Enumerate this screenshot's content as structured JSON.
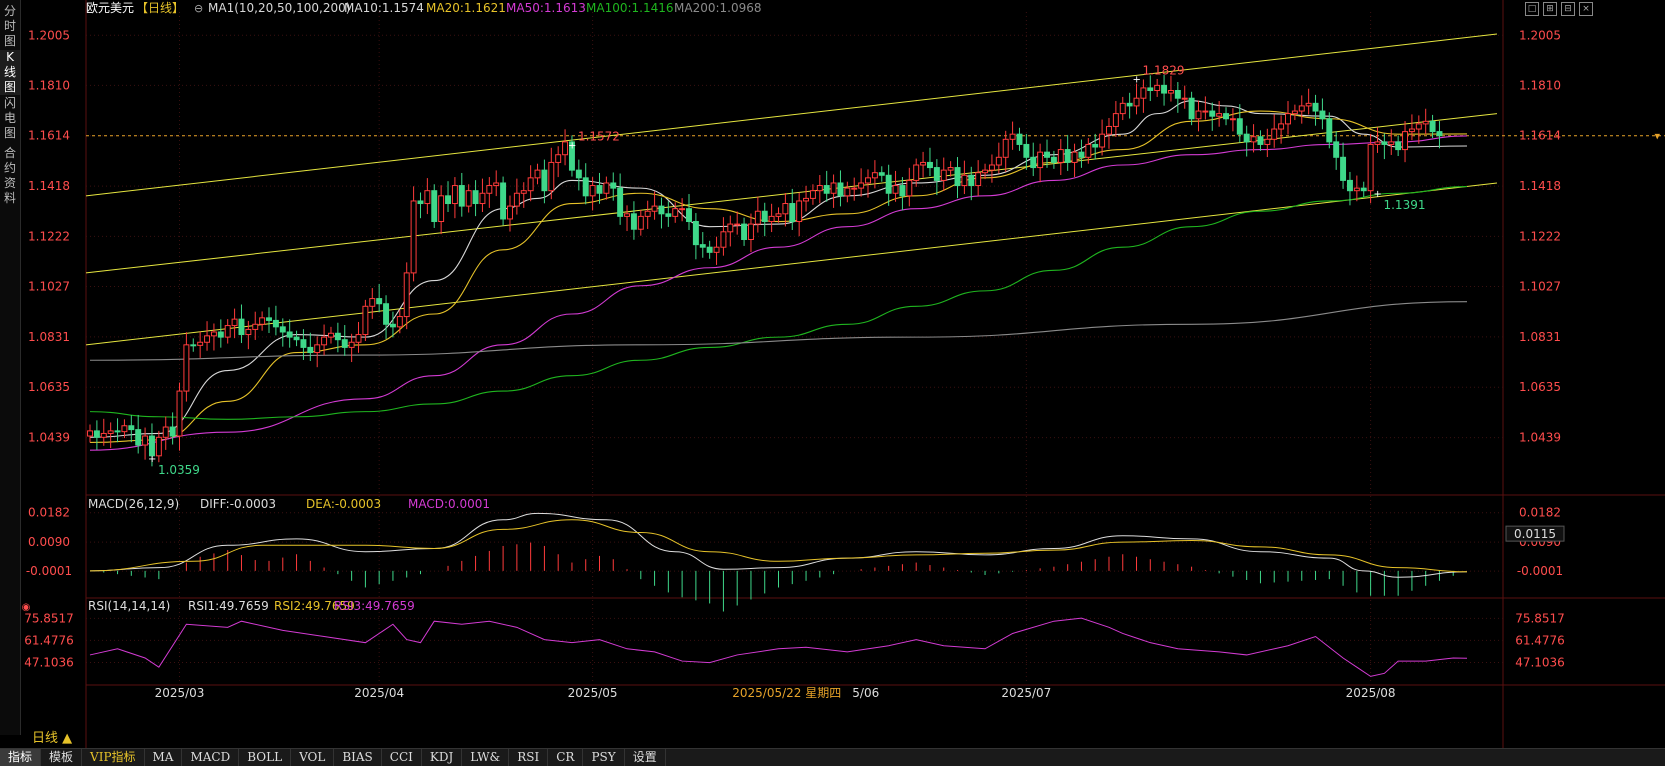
{
  "sidebar": {
    "tabs": [
      {
        "label": "分时图",
        "active": false
      },
      {
        "label": "K线图",
        "active": true
      },
      {
        "label": "闪电图",
        "active": false
      },
      {
        "label": "合约资料",
        "active": false
      }
    ]
  },
  "header": {
    "symbol": "欧元美元",
    "period_bracket": "【日线】",
    "ma_legend": [
      {
        "text": "MA1(10,20,50,100,200)",
        "color": "#d8d8d8"
      },
      {
        "text": "MA10:1.1574",
        "color": "#d8d8d8"
      },
      {
        "text": "MA20:1.1621",
        "color": "#e6c229"
      },
      {
        "text": "MA50:1.1613",
        "color": "#d33bd3"
      },
      {
        "text": "MA100:1.1416",
        "color": "#1fb51f"
      },
      {
        "text": "MA200:1.0968",
        "color": "#8a8a8a"
      }
    ]
  },
  "window_controls": [
    "□",
    "⊞",
    "⊟",
    "×"
  ],
  "chart_data": {
    "type": "candlestick",
    "price_axis_ticks": [
      "1.2005",
      "1.1810",
      "1.1614",
      "1.1418",
      "1.1222",
      "1.1027",
      "1.0831",
      "1.0635",
      "1.0439"
    ],
    "price_range": [
      1.034,
      1.208
    ],
    "current_price_label": "1.1614",
    "annotations": [
      {
        "text": "1.0359",
        "value": 1.0359,
        "bar": 9
      },
      {
        "text": "1.1572",
        "value": 1.1572,
        "bar": 70
      },
      {
        "text": "1.1829",
        "value": 1.1829,
        "bar": 152
      },
      {
        "text": "1.1391",
        "value": 1.1391,
        "bar": 187
      }
    ],
    "x_axis_labels": [
      {
        "text": "2025/03",
        "bar": 13
      },
      {
        "text": "2025/04",
        "bar": 42
      },
      {
        "text": "2025/05",
        "bar": 73
      },
      {
        "text": "2025/07",
        "bar": 136
      },
      {
        "text": "2025/08",
        "bar": 186
      }
    ],
    "crosshair_date": "2025/05/22 星期四",
    "crosshair_suffix": "5/06",
    "closes": [
      1.0465,
      1.044,
      1.0455,
      1.0465,
      1.0462,
      1.0485,
      1.047,
      1.041,
      1.0445,
      1.0368,
      1.044,
      1.048,
      1.0445,
      1.062,
      1.08,
      1.0798,
      1.081,
      1.0835,
      1.085,
      1.083,
      1.0875,
      1.09,
      1.084,
      1.086,
      1.088,
      1.0905,
      1.0895,
      1.087,
      1.085,
      1.083,
      1.082,
      1.079,
      1.077,
      1.08,
      1.083,
      1.0845,
      1.082,
      1.079,
      1.081,
      1.084,
      1.095,
      1.098,
      1.096,
      1.088,
      1.087,
      1.091,
      1.108,
      1.136,
      1.135,
      1.14,
      1.128,
      1.138,
      1.135,
      1.142,
      1.134,
      1.14,
      1.135,
      1.139,
      1.142,
      1.143,
      1.129,
      1.134,
      1.139,
      1.14,
      1.145,
      1.148,
      1.14,
      1.151,
      1.154,
      1.159,
      1.148,
      1.145,
      1.138,
      1.142,
      1.139,
      1.143,
      1.141,
      1.13,
      1.131,
      1.125,
      1.13,
      1.132,
      1.134,
      1.131,
      1.13,
      1.133,
      1.133,
      1.128,
      1.119,
      1.118,
      1.116,
      1.118,
      1.124,
      1.127,
      1.127,
      1.121,
      1.127,
      1.132,
      1.128,
      1.13,
      1.131,
      1.135,
      1.128,
      1.136,
      1.137,
      1.14,
      1.142,
      1.139,
      1.143,
      1.138,
      1.141,
      1.141,
      1.143,
      1.145,
      1.147,
      1.146,
      1.139,
      1.142,
      1.138,
      1.144,
      1.15,
      1.151,
      1.149,
      1.144,
      1.148,
      1.149,
      1.142,
      1.146,
      1.142,
      1.147,
      1.148,
      1.15,
      1.153,
      1.16,
      1.162,
      1.158,
      1.153,
      1.149,
      1.155,
      1.153,
      1.151,
      1.156,
      1.151,
      1.155,
      1.153,
      1.158,
      1.157,
      1.162,
      1.165,
      1.17,
      1.174,
      1.173,
      1.176,
      1.18,
      1.179,
      1.181,
      1.178,
      1.179,
      1.176,
      1.176,
      1.168,
      1.171,
      1.171,
      1.169,
      1.17,
      1.168,
      1.168,
      1.162,
      1.159,
      1.161,
      1.158,
      1.16,
      1.164,
      1.166,
      1.17,
      1.171,
      1.173,
      1.174,
      1.171,
      1.168,
      1.159,
      1.153,
      1.144,
      1.14,
      1.141,
      1.14,
      1.158,
      1.159,
      1.158,
      1.159,
      1.156,
      1.163,
      1.164,
      1.166,
      1.167,
      1.163,
      1.1614
    ],
    "moving_averages": [
      {
        "name": "MA10",
        "color": "#d8d8d8",
        "points": [
          [
            0,
            1.044
          ],
          [
            10,
            1.0455
          ],
          [
            20,
            1.07
          ],
          [
            30,
            1.084
          ],
          [
            40,
            1.083
          ],
          [
            50,
            1.105
          ],
          [
            60,
            1.133
          ],
          [
            65,
            1.137
          ],
          [
            70,
            1.144
          ],
          [
            80,
            1.141
          ],
          [
            90,
            1.126
          ],
          [
            100,
            1.127
          ],
          [
            110,
            1.138
          ],
          [
            120,
            1.143
          ],
          [
            130,
            1.146
          ],
          [
            140,
            1.154
          ],
          [
            150,
            1.162
          ],
          [
            155,
            1.17
          ],
          [
            160,
            1.175
          ],
          [
            165,
            1.173
          ],
          [
            170,
            1.17
          ],
          [
            180,
            1.169
          ],
          [
            185,
            1.162
          ],
          [
            190,
            1.157
          ],
          [
            200,
            1.1574
          ]
        ]
      },
      {
        "name": "MA20",
        "color": "#e6c229",
        "points": [
          [
            0,
            1.042
          ],
          [
            10,
            1.043
          ],
          [
            20,
            1.058
          ],
          [
            30,
            1.077
          ],
          [
            40,
            1.08
          ],
          [
            50,
            1.092
          ],
          [
            60,
            1.117
          ],
          [
            70,
            1.135
          ],
          [
            80,
            1.139
          ],
          [
            90,
            1.133
          ],
          [
            100,
            1.128
          ],
          [
            110,
            1.131
          ],
          [
            120,
            1.138
          ],
          [
            130,
            1.145
          ],
          [
            140,
            1.151
          ],
          [
            150,
            1.156
          ],
          [
            160,
            1.167
          ],
          [
            170,
            1.171
          ],
          [
            180,
            1.168
          ],
          [
            190,
            1.162
          ],
          [
            200,
            1.1621
          ]
        ]
      },
      {
        "name": "MA50",
        "color": "#d33bd3",
        "points": [
          [
            0,
            1.039
          ],
          [
            20,
            1.046
          ],
          [
            40,
            1.059
          ],
          [
            50,
            1.068
          ],
          [
            60,
            1.08
          ],
          [
            70,
            1.092
          ],
          [
            80,
            1.103
          ],
          [
            90,
            1.11
          ],
          [
            100,
            1.118
          ],
          [
            110,
            1.126
          ],
          [
            120,
            1.133
          ],
          [
            130,
            1.138
          ],
          [
            140,
            1.144
          ],
          [
            150,
            1.15
          ],
          [
            160,
            1.154
          ],
          [
            170,
            1.156
          ],
          [
            180,
            1.158
          ],
          [
            190,
            1.159
          ],
          [
            200,
            1.1613
          ]
        ]
      },
      {
        "name": "MA100",
        "color": "#1fb51f",
        "points": [
          [
            0,
            1.054
          ],
          [
            10,
            1.052
          ],
          [
            20,
            1.051
          ],
          [
            30,
            1.052
          ],
          [
            40,
            1.054
          ],
          [
            50,
            1.057
          ],
          [
            60,
            1.062
          ],
          [
            70,
            1.068
          ],
          [
            80,
            1.074
          ],
          [
            90,
            1.079
          ],
          [
            100,
            1.083
          ],
          [
            110,
            1.088
          ],
          [
            120,
            1.095
          ],
          [
            130,
            1.101
          ],
          [
            140,
            1.109
          ],
          [
            150,
            1.118
          ],
          [
            160,
            1.126
          ],
          [
            170,
            1.132
          ],
          [
            180,
            1.136
          ],
          [
            190,
            1.139
          ],
          [
            200,
            1.1416
          ]
        ]
      },
      {
        "name": "MA200",
        "color": "#8a8a8a",
        "points": [
          [
            0,
            1.074
          ],
          [
            40,
            1.076
          ],
          [
            80,
            1.08
          ],
          [
            120,
            1.083
          ],
          [
            160,
            1.088
          ],
          [
            200,
            1.0968
          ]
        ]
      }
    ],
    "trendlines": [
      {
        "from": [
          0,
          1.138
        ],
        "to": [
          210,
          1.201
        ]
      },
      {
        "from": [
          0,
          1.108
        ],
        "to": [
          210,
          1.17
        ]
      },
      {
        "from": [
          0,
          1.08
        ],
        "to": [
          210,
          1.143
        ]
      }
    ],
    "macd": {
      "title": "MACD(26,12,9)",
      "diff": "DIFF:-0.0003",
      "dea": "DEA:-0.0003",
      "macd": "MACD:0.0001",
      "ticks": [
        "0.0182",
        "0.0090",
        "-0.0001"
      ],
      "current_label": "0.0115",
      "range": [
        -0.006,
        0.02
      ],
      "diff_points": [
        [
          0,
          0.0
        ],
        [
          10,
          0.001
        ],
        [
          20,
          0.008
        ],
        [
          30,
          0.01
        ],
        [
          40,
          0.006
        ],
        [
          50,
          0.007
        ],
        [
          60,
          0.016
        ],
        [
          65,
          0.018
        ],
        [
          75,
          0.016
        ],
        [
          85,
          0.006
        ],
        [
          92,
          0.0005
        ],
        [
          100,
          0.001
        ],
        [
          110,
          0.004
        ],
        [
          120,
          0.006
        ],
        [
          130,
          0.005
        ],
        [
          140,
          0.007
        ],
        [
          150,
          0.011
        ],
        [
          160,
          0.01
        ],
        [
          170,
          0.006
        ],
        [
          180,
          0.004
        ],
        [
          185,
          0.0
        ],
        [
          190,
          -0.002
        ],
        [
          200,
          -0.0003
        ]
      ],
      "dea_points": [
        [
          0,
          0.0
        ],
        [
          15,
          0.003
        ],
        [
          25,
          0.008
        ],
        [
          40,
          0.008
        ],
        [
          50,
          0.007
        ],
        [
          60,
          0.013
        ],
        [
          70,
          0.016
        ],
        [
          80,
          0.012
        ],
        [
          90,
          0.006
        ],
        [
          100,
          0.003
        ],
        [
          110,
          0.004
        ],
        [
          120,
          0.005
        ],
        [
          130,
          0.0055
        ],
        [
          140,
          0.0065
        ],
        [
          150,
          0.009
        ],
        [
          160,
          0.0095
        ],
        [
          170,
          0.0075
        ],
        [
          180,
          0.005
        ],
        [
          190,
          0.001
        ],
        [
          200,
          -0.0003
        ]
      ]
    },
    "rsi": {
      "title": "RSI(14,14,14)",
      "rsi1": "RSI1:49.7659",
      "rsi2": "RSI2:49.7659",
      "rsi3": "RSI3:49.7659",
      "ticks": [
        "75.8517",
        "61.4776",
        "47.1036"
      ],
      "range": [
        35,
        80
      ],
      "points": [
        [
          0,
          52
        ],
        [
          4,
          56
        ],
        [
          8,
          50
        ],
        [
          10,
          44
        ],
        [
          14,
          72
        ],
        [
          20,
          70
        ],
        [
          22,
          74
        ],
        [
          28,
          68
        ],
        [
          34,
          64
        ],
        [
          40,
          60
        ],
        [
          44,
          72
        ],
        [
          46,
          62
        ],
        [
          48,
          60
        ],
        [
          50,
          74
        ],
        [
          54,
          72
        ],
        [
          58,
          74
        ],
        [
          62,
          70
        ],
        [
          66,
          62
        ],
        [
          70,
          60
        ],
        [
          74,
          62
        ],
        [
          78,
          56
        ],
        [
          82,
          54
        ],
        [
          86,
          48
        ],
        [
          90,
          47
        ],
        [
          94,
          52
        ],
        [
          100,
          56
        ],
        [
          104,
          57
        ],
        [
          110,
          54
        ],
        [
          116,
          58
        ],
        [
          120,
          62
        ],
        [
          124,
          58
        ],
        [
          130,
          56
        ],
        [
          134,
          66
        ],
        [
          140,
          74
        ],
        [
          144,
          76
        ],
        [
          148,
          70
        ],
        [
          150,
          66
        ],
        [
          154,
          60
        ],
        [
          158,
          56
        ],
        [
          164,
          54
        ],
        [
          168,
          52
        ],
        [
          174,
          58
        ],
        [
          178,
          64
        ],
        [
          182,
          50
        ],
        [
          184,
          44
        ],
        [
          186,
          38
        ],
        [
          188,
          40
        ],
        [
          190,
          48
        ],
        [
          194,
          48
        ],
        [
          198,
          50
        ],
        [
          200,
          49.8
        ]
      ]
    }
  },
  "period_button": "日线 ▲",
  "bottom_tabs": [
    {
      "label": "指标",
      "active": true
    },
    {
      "label": "模板",
      "active": false
    },
    {
      "label": "VIP指标",
      "vip": true
    },
    {
      "label": "MA"
    },
    {
      "label": "MACD"
    },
    {
      "label": "BOLL"
    },
    {
      "label": "VOL"
    },
    {
      "label": "BIAS"
    },
    {
      "label": "CCI"
    },
    {
      "label": "KDJ"
    },
    {
      "label": "LW&"
    },
    {
      "label": "RSI"
    },
    {
      "label": "CR"
    },
    {
      "label": "PSY"
    },
    {
      "label": "设置"
    }
  ],
  "colors": {
    "up": "#ff3b3b",
    "down": "#3fd88a",
    "trendline": "#e6e640",
    "price_label": "#ff4d4d",
    "dotted": "#e6a229",
    "grid": "#3a1010"
  }
}
